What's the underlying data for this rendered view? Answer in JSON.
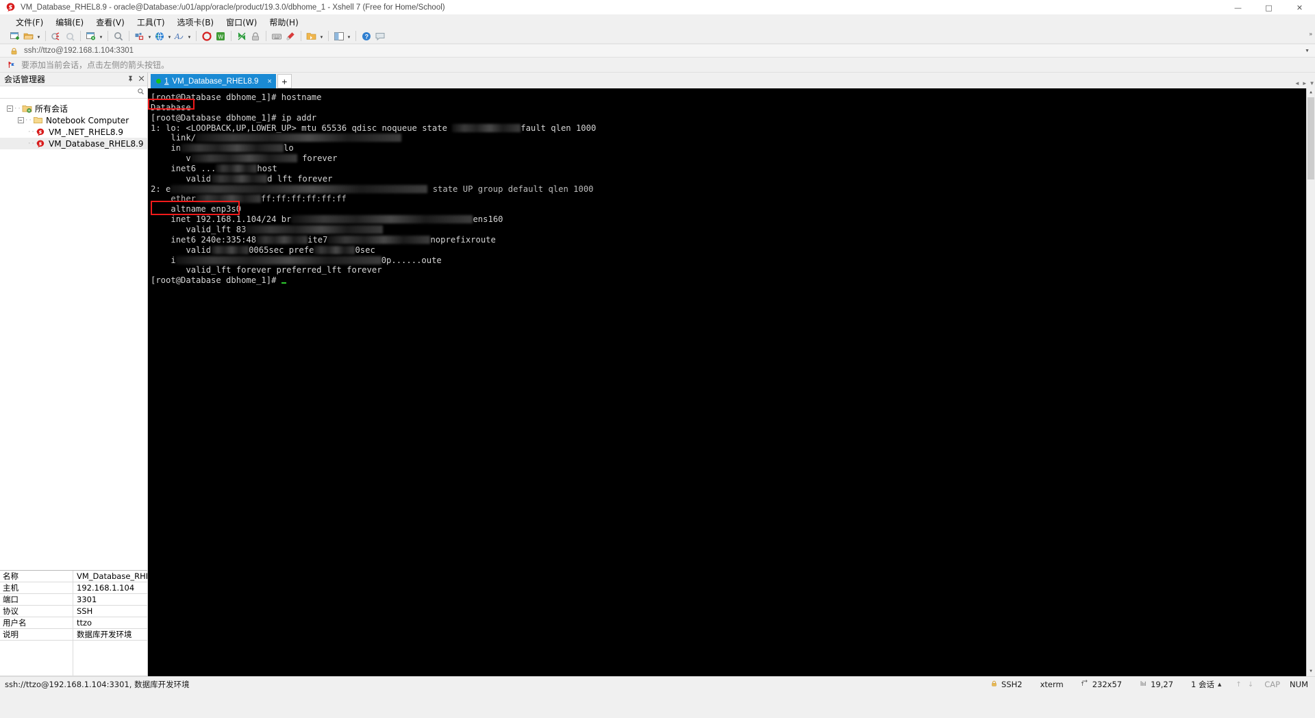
{
  "window": {
    "title": "VM_Database_RHEL8.9 - oracle@Database:/u01/app/oracle/product/19.3.0/dbhome_1 - Xshell 7 (Free for Home/School)",
    "minimize": "—",
    "maximize": "□",
    "close": "✕",
    "app_icon": "xshell-logo-icon"
  },
  "menubar": {
    "items": [
      {
        "label": "文件(F)",
        "name": "menu-file"
      },
      {
        "label": "编辑(E)",
        "name": "menu-edit"
      },
      {
        "label": "查看(V)",
        "name": "menu-view"
      },
      {
        "label": "工具(T)",
        "name": "menu-tools"
      },
      {
        "label": "选项卡(B)",
        "name": "menu-tabs"
      },
      {
        "label": "窗口(W)",
        "name": "menu-window"
      },
      {
        "label": "帮助(H)",
        "name": "menu-help"
      }
    ]
  },
  "toolbar": {
    "overflow": "»",
    "buttons": [
      "new-session-icon",
      "open-folder-icon",
      "open-folder-caret",
      "sep",
      "disconnect-icon",
      "reconnect-icon",
      "sep",
      "session-properties-icon",
      "session-properties-caret",
      "sep",
      "find-icon",
      "sep",
      "transfer-icon",
      "transfer-caret",
      "globe-icon",
      "globe-caret",
      "font-icon",
      "font-caret",
      "sep",
      "record-icon",
      "log-icon",
      "sep",
      "compose-icon",
      "lock-icon",
      "sep",
      "keyboard-icon",
      "highlight-icon",
      "sep",
      "folder-open-icon",
      "folder-caret",
      "sep",
      "layout-icon",
      "layout-caret",
      "sep",
      "help-icon",
      "comment-icon"
    ]
  },
  "addressbar": {
    "icon": "lock-icon",
    "value": "ssh://ttzo@192.168.1.104:3301",
    "placeholder": "ssh://ttzo@192.168.1.104:3301",
    "caret": "▼"
  },
  "hintbar": {
    "icon": "red-arrow-flag-icon",
    "text": "要添加当前会话，点击左侧的箭头按钮。"
  },
  "session_manager": {
    "title": "会话管理器",
    "pin_icon": "pin-icon",
    "close_icon": "close-icon",
    "search_icon": "search-icon",
    "tree": [
      {
        "label": "所有会话",
        "name": "tree-node-all-sessions",
        "depth": 0,
        "expander": "−",
        "icon": "sessions-folder-icon",
        "selected": false
      },
      {
        "label": "Notebook Computer",
        "name": "tree-node-notebook-computer",
        "depth": 1,
        "expander": "−",
        "icon": "folder-icon",
        "selected": false
      },
      {
        "label": "VM_.NET_RHEL8.9",
        "name": "tree-node-vm-net-rhel89",
        "depth": 2,
        "expander": "",
        "icon": "xshell-session-icon",
        "selected": false
      },
      {
        "label": "VM_Database_RHEL8.9",
        "name": "tree-node-vm-database-rhel89",
        "depth": 2,
        "expander": "",
        "icon": "xshell-session-icon",
        "selected": true
      }
    ]
  },
  "properties": {
    "rows": [
      {
        "key": "名称",
        "value": "VM_Database_RHE...",
        "name": "property-name"
      },
      {
        "key": "主机",
        "value": "192.168.1.104",
        "name": "property-host"
      },
      {
        "key": "端口",
        "value": "3301",
        "name": "property-port"
      },
      {
        "key": "协议",
        "value": "SSH",
        "name": "property-protocol"
      },
      {
        "key": "用户名",
        "value": "ttzo",
        "name": "property-username"
      },
      {
        "key": "说明",
        "value": "数据库开发环境",
        "name": "property-description"
      }
    ]
  },
  "tabs": {
    "items": [
      {
        "status_dot": "connected-dot-icon",
        "number": "1",
        "name": "VM_Database_RHEL8.9",
        "close": "×",
        "active": true
      }
    ],
    "new_tab": "+",
    "nav_left": "◀",
    "nav_right": "▶",
    "nav_menu": "▼"
  },
  "terminal": {
    "prompt1": "[root@Database dbhome_1]# hostname",
    "hostname_output": "Database",
    "prompt2": "[root@Database dbhome_1]# ip addr",
    "lo_line": "1: lo: <LOOPBACK,UP,LOWER_UP> mtu 65536 qdisc noqueue state ",
    "lo_line_tail": "fault qlen 1000",
    "link_label": "link/",
    "inet_label": "in",
    "lo_name": "lo",
    "valid_v": "v",
    "forever": "forever",
    "inet6_label": "inet6 ...",
    "host_frag": "host",
    "valid_label": "valid",
    "valid_tail": "d lft forever",
    "eth_index": "2: e",
    "eth_tail": "state UP group default qlen 1000",
    "ether_label": "ether",
    "ether_tail": "ff:ff:ff:ff:ff:ff",
    "altname": "altname enp3s0",
    "inet_addr_line": "inet 192.168.1.104/24 br",
    "inet_addr_tail": "ens160",
    "valid_lft_line": "valid_lft 83",
    "inet6_v6": "inet6 240e:335:48",
    "inet6_frag": "ite7",
    "noprefixroute": "noprefixroute",
    "valid_lft6": "valid",
    "sec_label": "0065sec prefe",
    "sec_tail": "0sec",
    "last_inet6": "i",
    "last_inet6_tail": "0p......oute",
    "valid_lft_forever": "valid_lft forever preferred_lft forever",
    "prompt3": "[root@Database dbhome_1]# ",
    "cursor": "_",
    "highlight_color": "#f01b1b"
  },
  "statusbar": {
    "left": "ssh://ttzo@192.168.1.104:3301, 数据库开发环境",
    "ssh_icon": "lock-icon",
    "ssh": "SSH2",
    "term_type": "xterm",
    "size_icon": "resize-icon",
    "size": "232x57",
    "pos_icon": "cursor-pos-icon",
    "pos": "19,27",
    "sessions": "1 会话",
    "sessions_caret": "▲",
    "up_arrow": "↑",
    "down_arrow": "↓",
    "cap": "CAP",
    "num": "NUM"
  }
}
